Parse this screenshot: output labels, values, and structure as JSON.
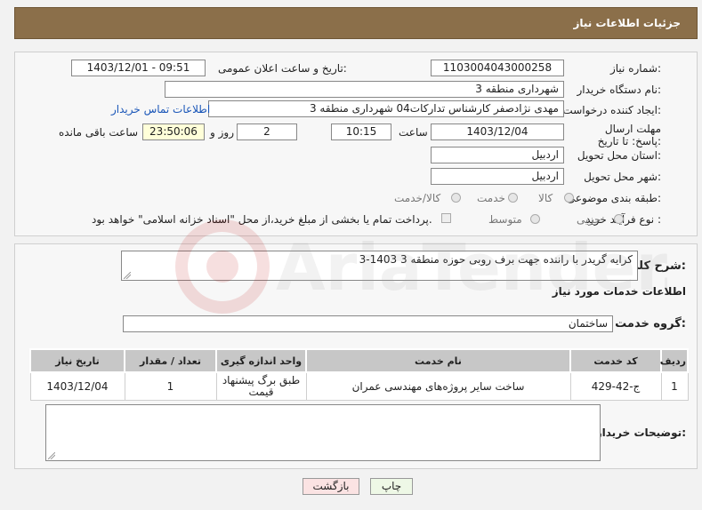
{
  "header": {
    "title": "جزئیات اطلاعات نیاز"
  },
  "form": {
    "need_number_label": "شماره نیاز:",
    "need_number": "1103004043000258",
    "announce_label": "تاریخ و ساعت اعلان عمومی:",
    "announce_value": "1403/12/01 - 09:51",
    "buyer_org_label": "نام دستگاه خریدار:",
    "buyer_org": "شهرداری منطقه 3",
    "creator_label": "ایجاد کننده درخواست:",
    "creator": "مهدی نژادصفر کارشناس تداركات04 شهرداری منطقه 3",
    "contact_link": "اطلاعات تماس خریدار",
    "deadline_label": "مهلت ارسال پاسخ: تا تاریخ:",
    "deadline_date": "1403/12/04",
    "time_label": "ساعت",
    "deadline_time": "10:15",
    "days_value": "2",
    "days_label": "روز و",
    "remaining_value": "23:50:06",
    "remaining_label": "ساعت باقی مانده",
    "province_label": "استان محل تحویل:",
    "province": "اردبیل",
    "city_label": "شهر محل تحویل:",
    "city": "اردبیل",
    "category_label": "طبقه بندی موضوعی:",
    "category_options": [
      "کالا",
      "خدمت",
      "کالا/خدمت"
    ],
    "process_label": "نوع فرآیند خرید :",
    "process_options": [
      "جزیی",
      "متوسط"
    ],
    "payment_note": "پرداخت تمام یا بخشی از مبلغ خرید،از محل \"اسناد خزانه اسلامی\" خواهد بود."
  },
  "details": {
    "summary_label": "شرح کلی نیاز:",
    "summary": "کرایه گریدر با راننده جهت برف روبی حوزه منطقه 3 1403-3",
    "services_title": "اطلاعات خدمات مورد نیاز",
    "service_group_label": "گروه خدمت:",
    "service_group": "ساختمان",
    "table": {
      "headers": [
        "ردیف",
        "کد خدمت",
        "نام خدمت",
        "واحد اندازه گیری",
        "تعداد / مقدار",
        "تاریخ نیاز"
      ],
      "rows": [
        [
          "1",
          "ج-42-429",
          "ساخت سایر پروژه‌های مهندسی عمران",
          "طبق برگ پیشنهاد قیمت",
          "1",
          "1403/12/04"
        ]
      ]
    },
    "buyer_notes_label": "توضیحات خریدار:",
    "buyer_notes": ""
  },
  "buttons": {
    "print": "چاپ",
    "back": "بازگشت"
  },
  "colors": {
    "header_bg": "#8b6f4a",
    "table_header_bg": "#c7c7c7",
    "link": "#1a56b8",
    "back_button_bg": "#fbe3e3",
    "print_button_bg": "#eef8e6"
  }
}
